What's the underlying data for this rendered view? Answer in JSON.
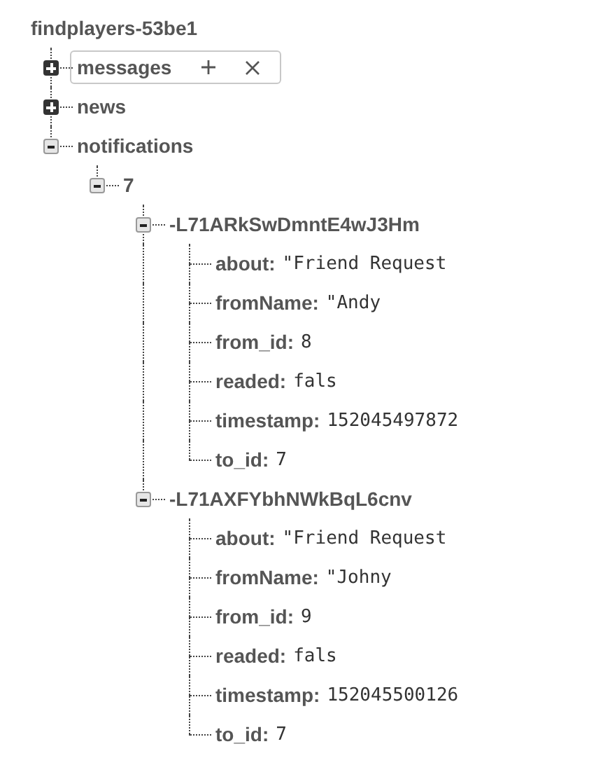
{
  "tree": {
    "kind": "root",
    "label": "findplayers-53be1",
    "children": [
      {
        "kind": "branch",
        "label": "messages",
        "expanded": false,
        "hovered": true
      },
      {
        "kind": "branch",
        "label": "news",
        "expanded": false,
        "hovered": false
      },
      {
        "kind": "branch",
        "label": "notifications",
        "expanded": true,
        "hovered": false,
        "children": [
          {
            "kind": "branch",
            "label": "7",
            "expanded": true,
            "hovered": false,
            "children": [
              {
                "kind": "branch",
                "label": "-L71ARkSwDmntE4wJ3Hm",
                "expanded": true,
                "hovered": false,
                "children": [
                  {
                    "kind": "leaf",
                    "label": "about:",
                    "value": "\"Friend Request"
                  },
                  {
                    "kind": "leaf",
                    "label": "fromName:",
                    "value": "\"Andy"
                  },
                  {
                    "kind": "leaf",
                    "label": "from_id:",
                    "value": "8"
                  },
                  {
                    "kind": "leaf",
                    "label": "readed:",
                    "value": "fals"
                  },
                  {
                    "kind": "leaf",
                    "label": "timestamp:",
                    "value": "152045497872"
                  },
                  {
                    "kind": "leaf",
                    "label": "to_id:",
                    "value": "7"
                  }
                ]
              },
              {
                "kind": "branch",
                "label": "-L71AXFYbhNWkBqL6cnv",
                "expanded": true,
                "hovered": false,
                "children": [
                  {
                    "kind": "leaf",
                    "label": "about:",
                    "value": "\"Friend Request"
                  },
                  {
                    "kind": "leaf",
                    "label": "fromName:",
                    "value": "\"Johny"
                  },
                  {
                    "kind": "leaf",
                    "label": "from_id:",
                    "value": "9"
                  },
                  {
                    "kind": "leaf",
                    "label": "readed:",
                    "value": "fals"
                  },
                  {
                    "kind": "leaf",
                    "label": "timestamp:",
                    "value": "152045500126"
                  },
                  {
                    "kind": "leaf",
                    "label": "to_id:",
                    "value": "7"
                  }
                ]
              }
            ]
          }
        ]
      }
    ]
  }
}
